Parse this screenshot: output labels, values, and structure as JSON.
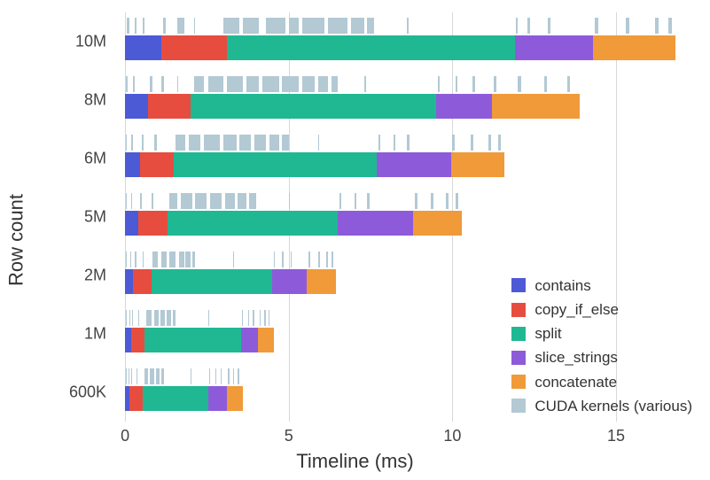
{
  "chart_data": {
    "type": "bar",
    "title": "",
    "xlabel": "Timeline (ms)",
    "ylabel": "Row count",
    "xlim": [
      -0.3,
      17.3
    ],
    "x_ticks": [
      0,
      5,
      10,
      15
    ],
    "categories": [
      "10M",
      "8M",
      "6M",
      "5M",
      "2M",
      "1M",
      "600K"
    ],
    "series": [
      {
        "name": "contains",
        "color": "#4c5ad6"
      },
      {
        "name": "copy_if_else",
        "color": "#e64d3f"
      },
      {
        "name": "split",
        "color": "#20b892"
      },
      {
        "name": "slice_strings",
        "color": "#8d5bd9"
      },
      {
        "name": "concatenate",
        "color": "#f09a3a"
      },
      {
        "name": "CUDA kernels (various)",
        "color": "#b3c9d4"
      }
    ],
    "rows": [
      {
        "label": "10M",
        "segments": [
          {
            "op": "contains",
            "start": 0.0,
            "end": 1.1
          },
          {
            "op": "copy_if_else",
            "start": 1.1,
            "end": 3.1
          },
          {
            "op": "split",
            "start": 3.1,
            "end": 11.9
          },
          {
            "op": "slice_strings",
            "start": 11.9,
            "end": 14.3
          },
          {
            "op": "concatenate",
            "start": 14.3,
            "end": 16.8
          }
        ],
        "kernels": [
          [
            0.05,
            0.12
          ],
          [
            0.3,
            0.34
          ],
          [
            0.55,
            0.6
          ],
          [
            1.15,
            1.25
          ],
          [
            1.6,
            1.8
          ],
          [
            2.1,
            2.12
          ],
          [
            3.0,
            3.5
          ],
          [
            3.6,
            4.1
          ],
          [
            4.3,
            4.9
          ],
          [
            5.0,
            5.3
          ],
          [
            5.4,
            6.1
          ],
          [
            6.2,
            6.8
          ],
          [
            6.9,
            7.3
          ],
          [
            7.4,
            7.6
          ],
          [
            8.6,
            8.65
          ],
          [
            11.95,
            12.0
          ],
          [
            12.3,
            12.36
          ],
          [
            12.9,
            13.0
          ],
          [
            14.35,
            14.45
          ],
          [
            15.3,
            15.4
          ],
          [
            16.2,
            16.3
          ],
          [
            16.6,
            16.7
          ]
        ]
      },
      {
        "label": "8M",
        "segments": [
          {
            "op": "contains",
            "start": 0.0,
            "end": 0.7
          },
          {
            "op": "copy_if_else",
            "start": 0.7,
            "end": 2.0
          },
          {
            "op": "split",
            "start": 2.0,
            "end": 9.5
          },
          {
            "op": "slice_strings",
            "start": 9.5,
            "end": 11.2
          },
          {
            "op": "concatenate",
            "start": 11.2,
            "end": 13.9
          }
        ],
        "kernels": [
          [
            0.03,
            0.08
          ],
          [
            0.25,
            0.3
          ],
          [
            0.75,
            0.85
          ],
          [
            1.1,
            1.2
          ],
          [
            1.6,
            1.62
          ],
          [
            2.1,
            2.4
          ],
          [
            2.55,
            3.0
          ],
          [
            3.1,
            3.6
          ],
          [
            3.7,
            4.1
          ],
          [
            4.2,
            4.7
          ],
          [
            4.8,
            5.3
          ],
          [
            5.4,
            5.8
          ],
          [
            5.9,
            6.2
          ],
          [
            6.3,
            6.5
          ],
          [
            7.3,
            7.35
          ],
          [
            9.55,
            9.6
          ],
          [
            10.1,
            10.16
          ],
          [
            10.6,
            10.68
          ],
          [
            11.25,
            11.35
          ],
          [
            12.0,
            12.1
          ],
          [
            12.8,
            12.9
          ],
          [
            13.5,
            13.6
          ]
        ]
      },
      {
        "label": "6M",
        "segments": [
          {
            "op": "contains",
            "start": 0.0,
            "end": 0.45
          },
          {
            "op": "copy_if_else",
            "start": 0.45,
            "end": 1.5
          },
          {
            "op": "split",
            "start": 1.5,
            "end": 7.7
          },
          {
            "op": "slice_strings",
            "start": 7.7,
            "end": 9.95
          },
          {
            "op": "concatenate",
            "start": 9.95,
            "end": 11.6
          }
        ],
        "kernels": [
          [
            0.02,
            0.06
          ],
          [
            0.2,
            0.24
          ],
          [
            0.5,
            0.58
          ],
          [
            0.9,
            0.96
          ],
          [
            1.55,
            1.85
          ],
          [
            1.95,
            2.3
          ],
          [
            2.4,
            2.9
          ],
          [
            3.0,
            3.4
          ],
          [
            3.5,
            3.85
          ],
          [
            3.95,
            4.3
          ],
          [
            4.4,
            4.7
          ],
          [
            4.8,
            5.0
          ],
          [
            5.9,
            5.94
          ],
          [
            7.75,
            7.8
          ],
          [
            8.2,
            8.26
          ],
          [
            8.6,
            8.68
          ],
          [
            10.0,
            10.08
          ],
          [
            10.55,
            10.63
          ],
          [
            11.1,
            11.18
          ],
          [
            11.4,
            11.48
          ]
        ]
      },
      {
        "label": "5M",
        "segments": [
          {
            "op": "contains",
            "start": 0.0,
            "end": 0.4
          },
          {
            "op": "copy_if_else",
            "start": 0.4,
            "end": 1.3
          },
          {
            "op": "split",
            "start": 1.3,
            "end": 6.5
          },
          {
            "op": "slice_strings",
            "start": 6.5,
            "end": 8.8
          },
          {
            "op": "concatenate",
            "start": 8.8,
            "end": 10.3
          }
        ],
        "kernels": [
          [
            0.02,
            0.05
          ],
          [
            0.18,
            0.22
          ],
          [
            0.45,
            0.52
          ],
          [
            0.8,
            0.86
          ],
          [
            1.35,
            1.6
          ],
          [
            1.7,
            2.05
          ],
          [
            2.15,
            2.5
          ],
          [
            2.6,
            2.95
          ],
          [
            3.05,
            3.35
          ],
          [
            3.45,
            3.7
          ],
          [
            3.8,
            4.0
          ],
          [
            5.0,
            5.04
          ],
          [
            6.55,
            6.6
          ],
          [
            7.0,
            7.06
          ],
          [
            7.4,
            7.48
          ],
          [
            8.85,
            8.93
          ],
          [
            9.35,
            9.43
          ],
          [
            9.8,
            9.88
          ],
          [
            10.1,
            10.18
          ]
        ]
      },
      {
        "label": "2M",
        "segments": [
          {
            "op": "contains",
            "start": 0.0,
            "end": 0.25
          },
          {
            "op": "copy_if_else",
            "start": 0.25,
            "end": 0.8
          },
          {
            "op": "split",
            "start": 0.8,
            "end": 4.5
          },
          {
            "op": "slice_strings",
            "start": 4.5,
            "end": 5.55
          },
          {
            "op": "concatenate",
            "start": 5.55,
            "end": 6.45
          }
        ],
        "kernels": [
          [
            0.02,
            0.04
          ],
          [
            0.15,
            0.18
          ],
          [
            0.3,
            0.34
          ],
          [
            0.55,
            0.58
          ],
          [
            0.85,
            1.0
          ],
          [
            1.1,
            1.28
          ],
          [
            1.35,
            1.55
          ],
          [
            1.65,
            1.8
          ],
          [
            1.85,
            2.0
          ],
          [
            2.05,
            2.15
          ],
          [
            3.3,
            3.34
          ],
          [
            4.55,
            4.58
          ],
          [
            4.8,
            4.84
          ],
          [
            5.05,
            5.1
          ],
          [
            5.6,
            5.66
          ],
          [
            5.9,
            5.96
          ],
          [
            6.15,
            6.21
          ],
          [
            6.3,
            6.36
          ]
        ]
      },
      {
        "label": "1M",
        "segments": [
          {
            "op": "contains",
            "start": 0.0,
            "end": 0.18
          },
          {
            "op": "copy_if_else",
            "start": 0.18,
            "end": 0.6
          },
          {
            "op": "split",
            "start": 0.6,
            "end": 3.55
          },
          {
            "op": "slice_strings",
            "start": 3.55,
            "end": 4.05
          },
          {
            "op": "concatenate",
            "start": 4.05,
            "end": 4.55
          }
        ],
        "kernels": [
          [
            0.02,
            0.03
          ],
          [
            0.12,
            0.14
          ],
          [
            0.22,
            0.25
          ],
          [
            0.4,
            0.43
          ],
          [
            0.65,
            0.8
          ],
          [
            0.88,
            1.02
          ],
          [
            1.08,
            1.22
          ],
          [
            1.28,
            1.4
          ],
          [
            1.45,
            1.55
          ],
          [
            2.55,
            2.58
          ],
          [
            3.58,
            3.61
          ],
          [
            3.75,
            3.78
          ],
          [
            3.9,
            3.94
          ],
          [
            4.1,
            4.14
          ],
          [
            4.25,
            4.29
          ],
          [
            4.38,
            4.42
          ]
        ]
      },
      {
        "label": "600K",
        "segments": [
          {
            "op": "contains",
            "start": 0.0,
            "end": 0.14
          },
          {
            "op": "copy_if_else",
            "start": 0.14,
            "end": 0.55
          },
          {
            "op": "split",
            "start": 0.55,
            "end": 2.55
          },
          {
            "op": "slice_strings",
            "start": 2.55,
            "end": 3.1
          },
          {
            "op": "concatenate",
            "start": 3.1,
            "end": 3.6
          }
        ],
        "kernels": [
          [
            0.02,
            0.03
          ],
          [
            0.1,
            0.12
          ],
          [
            0.18,
            0.21
          ],
          [
            0.35,
            0.38
          ],
          [
            0.58,
            0.7
          ],
          [
            0.76,
            0.88
          ],
          [
            0.94,
            1.05
          ],
          [
            1.1,
            1.18
          ],
          [
            2.0,
            2.03
          ],
          [
            2.58,
            2.61
          ],
          [
            2.75,
            2.78
          ],
          [
            2.92,
            2.96
          ],
          [
            3.14,
            3.18
          ],
          [
            3.3,
            3.34
          ],
          [
            3.45,
            3.49
          ]
        ]
      }
    ]
  },
  "legend_labels": {
    "l0": "contains",
    "l1": "copy_if_else",
    "l2": "split",
    "l3": "slice_strings",
    "l4": "concatenate",
    "l5": "CUDA kernels (various)"
  }
}
